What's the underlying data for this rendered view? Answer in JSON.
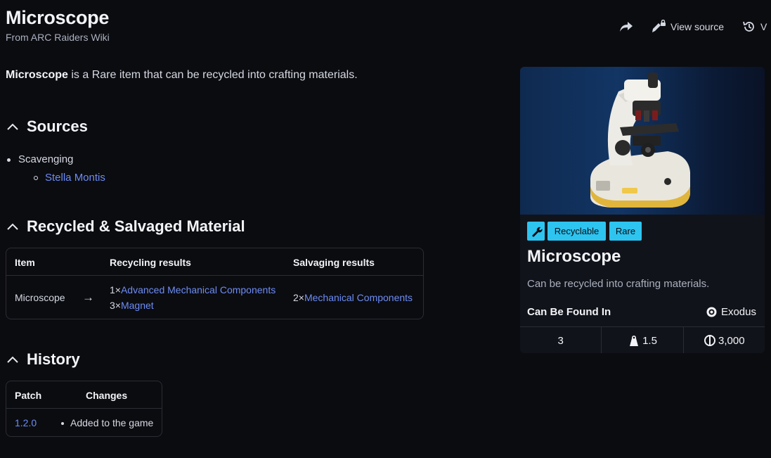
{
  "page": {
    "title": "Microscope",
    "subtitle": "From ARC Raiders Wiki"
  },
  "actions": {
    "view_source": "View source",
    "history_label": "V"
  },
  "intro": {
    "item_name": "Microscope",
    "text": " is a Rare item that can be recycled into crafting materials."
  },
  "sections": {
    "sources": "Sources",
    "recycled": "Recycled & Salvaged Material",
    "history": "History"
  },
  "sources": {
    "method": "Scavenging",
    "location": "Stella Montis"
  },
  "recycle_table": {
    "headers": [
      "Item",
      "Recycling results",
      "Salvaging results"
    ],
    "row": {
      "item": "Microscope",
      "arrow": "→",
      "recycling": [
        {
          "qty": "1×",
          "name": "Advanced Mechanical Components"
        },
        {
          "qty": "3×",
          "name": "Magnet"
        }
      ],
      "salvaging": [
        {
          "qty": "2×",
          "name": "Mechanical Components"
        }
      ]
    }
  },
  "history_table": {
    "headers": [
      "Patch",
      "Changes"
    ],
    "row": {
      "patch": "1.2.0",
      "change": "Added to the game"
    }
  },
  "infobox": {
    "badges": [
      "Recyclable",
      "Rare"
    ],
    "title": "Microscope",
    "description": "Can be recycled into crafting materials.",
    "found_label": "Can Be Found In",
    "location": "Exodus",
    "stats": {
      "stack": "3",
      "weight": "1.5",
      "value": "3,000"
    },
    "colors": {
      "badge": "#2ec4f0",
      "link": "#6d8cf5"
    }
  }
}
